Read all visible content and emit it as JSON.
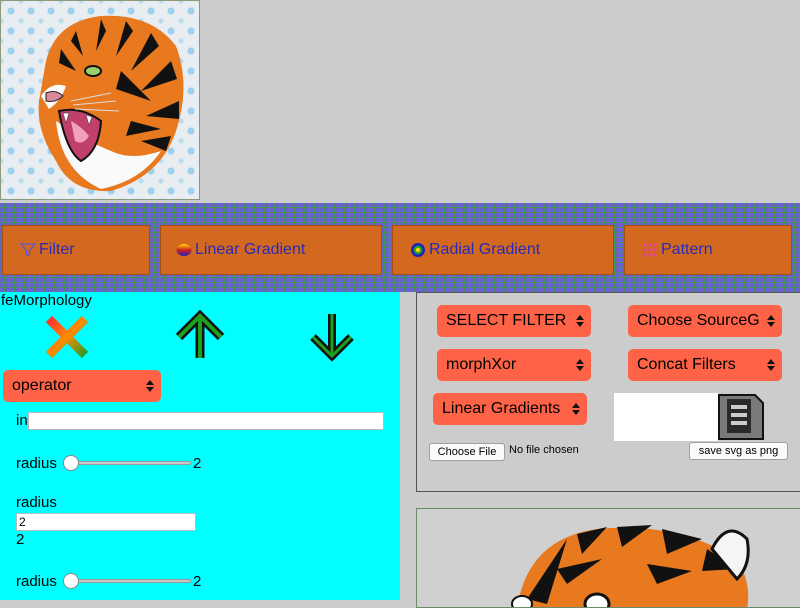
{
  "nav": {
    "tabs": [
      {
        "label": "Filter",
        "icon": "funnel-icon"
      },
      {
        "label": "Linear Gradient",
        "icon": "linear-gradient-icon"
      },
      {
        "label": "Radial Gradient",
        "icon": "radial-gradient-icon"
      },
      {
        "label": "Pattern",
        "icon": "pattern-icon"
      }
    ]
  },
  "editor": {
    "filter_name": "feMorphology",
    "operator_select": "operator",
    "in_label": "in",
    "in_value": "",
    "radius_label_1": "radius",
    "radius_value_1": "2",
    "radius_slider_1": 0,
    "radius_heading": "radius",
    "radius_input_value": "2",
    "radius_text_value": "2",
    "radius_label_2": "radius",
    "radius_value_2": "2",
    "radius_slider_2": 0
  },
  "controls": {
    "select_filter": "SELECT FILTER",
    "choose_source": "Choose SourceGr",
    "filter_preset": "morphXor",
    "concat_filters": "Concat Filters",
    "gradients_select": "Linear Gradients",
    "choose_file": "Choose File",
    "no_file": "No file chosen",
    "save_png": "save svg as png"
  },
  "colors": {
    "tab_bg": "#d2691e",
    "select_bg": "#ff6347",
    "panel_bg": "#00ffff",
    "tab_text": "#2a2ab8"
  }
}
